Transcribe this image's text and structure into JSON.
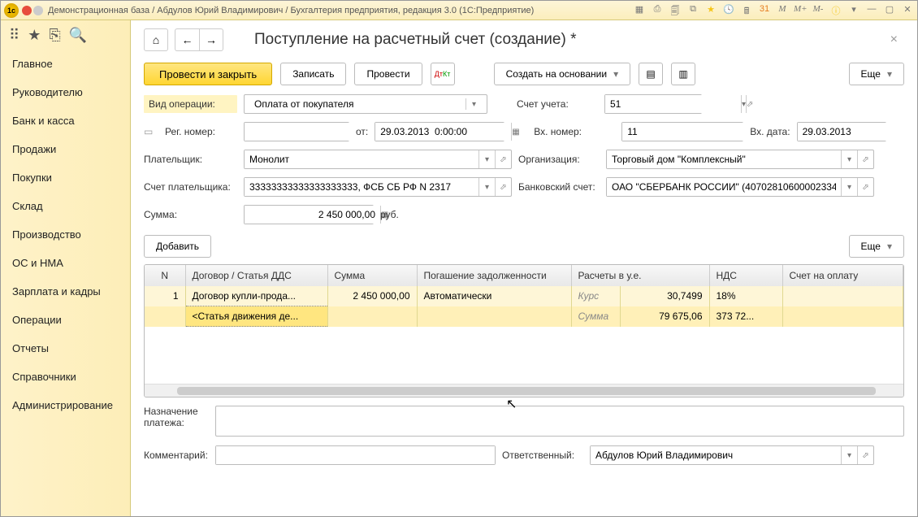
{
  "titlebar": {
    "text": "Демонстрационная база / Абдулов Юрий Владимирович / Бухгалтерия предприятия, редакция 3.0  (1С:Предприятие)"
  },
  "sidebar": {
    "items": [
      {
        "label": "Главное"
      },
      {
        "label": "Руководителю"
      },
      {
        "label": "Банк и касса"
      },
      {
        "label": "Продажи"
      },
      {
        "label": "Покупки"
      },
      {
        "label": "Склад"
      },
      {
        "label": "Производство"
      },
      {
        "label": "ОС и НМА"
      },
      {
        "label": "Зарплата и кадры"
      },
      {
        "label": "Операции"
      },
      {
        "label": "Отчеты"
      },
      {
        "label": "Справочники"
      },
      {
        "label": "Администрирование"
      }
    ]
  },
  "header": {
    "title": "Поступление на расчетный счет (создание) *"
  },
  "toolbar": {
    "post_close": "Провести и закрыть",
    "save": "Записать",
    "post": "Провести",
    "create_based": "Создать на основании",
    "more": "Еще"
  },
  "form": {
    "operation_type_label": "Вид операции:",
    "operation_type_value": "Оплата от покупателя",
    "account_label": "Счет учета:",
    "account_value": "51",
    "reg_num_label": "Рег. номер:",
    "reg_num_value": "",
    "from_label": "от:",
    "from_value": "29.03.2013  0:00:00",
    "in_num_label": "Вх. номер:",
    "in_num_value": "11",
    "in_date_label": "Вх. дата:",
    "in_date_value": "29.03.2013",
    "payer_label": "Плательщик:",
    "payer_value": "Монолит",
    "org_label": "Организация:",
    "org_value": "Торговый дом \"Комплексный\"",
    "payer_acc_label": "Счет плательщика:",
    "payer_acc_value": "33333333333333333333, ФСБ СБ РФ N 2317",
    "bank_acc_label": "Банковский счет:",
    "bank_acc_value": "ОАО \"СБЕРБАНК РОССИИ\" (40702810600002334",
    "sum_label": "Сумма:",
    "sum_value": "2 450 000,00",
    "sum_currency": "руб.",
    "add_btn": "Добавить",
    "more_btn": "Еще",
    "purpose_label": "Назначение платежа:",
    "purpose_value": "",
    "comment_label": "Комментарий:",
    "comment_value": "",
    "responsible_label": "Ответственный:",
    "responsible_value": "Абдулов Юрий Владимирович"
  },
  "table": {
    "headers": {
      "n": "N",
      "contract": "Договор / Статья ДДС",
      "sum": "Сумма",
      "repay": "Погашение задолженности",
      "calc": "Расчеты в у.е.",
      "vat": "НДС",
      "pay_acc": "Счет на оплату"
    },
    "row1": {
      "n": "1",
      "contract": "Договор купли-прода...",
      "sum": "2 450 000,00",
      "repay": "Автоматически",
      "calc_label": "Курс",
      "calc_value": "30,7499",
      "vat": "18%"
    },
    "row2": {
      "contract": "<Статья движения де...",
      "calc_label": "Сумма",
      "calc_value": "79 675,06",
      "vat": "373 72..."
    }
  }
}
